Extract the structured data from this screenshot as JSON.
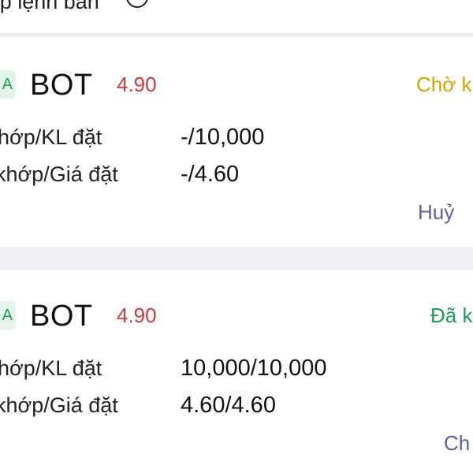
{
  "header": {
    "title": "ớp lệnh bán",
    "icon": "info-icon"
  },
  "orders": [
    {
      "badge": "A",
      "ticker": "BOT",
      "price": "4.90",
      "status": "Chờ k",
      "status_color": "#d6a400",
      "rows": [
        {
          "label": "hớp/KL đặt",
          "value": "-/10,000"
        },
        {
          "label": "khớp/Giá đặt",
          "value": "-/4.60"
        }
      ],
      "action": "Huỷ"
    },
    {
      "badge": "A",
      "ticker": "BOT",
      "price": "4.90",
      "status": "Đã k",
      "status_color": "#1f9a5a",
      "rows": [
        {
          "label": "hớp/KL đặt",
          "value": "10,000/10,000"
        },
        {
          "label": "khớp/Giá đặt",
          "value": "4.60/4.60"
        }
      ],
      "action": "Ch"
    }
  ],
  "colors": {
    "price": "#d0393b",
    "action": "#5b5fa8",
    "badge_bg": "#e3f4ea"
  }
}
